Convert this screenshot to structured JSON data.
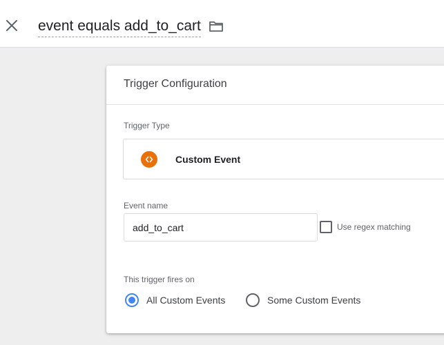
{
  "header": {
    "trigger_name": "event equals add_to_cart",
    "close_icon": "close-icon",
    "folder_icon": "folder-icon"
  },
  "card": {
    "title": "Trigger Configuration",
    "trigger_type_label": "Trigger Type",
    "trigger_type": {
      "name": "Custom Event",
      "icon": "code-brackets-icon",
      "icon_color": "#e8710a"
    },
    "event_name_label": "Event name",
    "event_name_value": "add_to_cart",
    "regex_label": "Use regex matching",
    "regex_checked": false,
    "fires_on_label": "This trigger fires on",
    "fires_on_options": [
      {
        "label": "All Custom Events",
        "selected": true
      },
      {
        "label": "Some Custom Events",
        "selected": false
      }
    ],
    "accent_color": "#4285f4"
  }
}
